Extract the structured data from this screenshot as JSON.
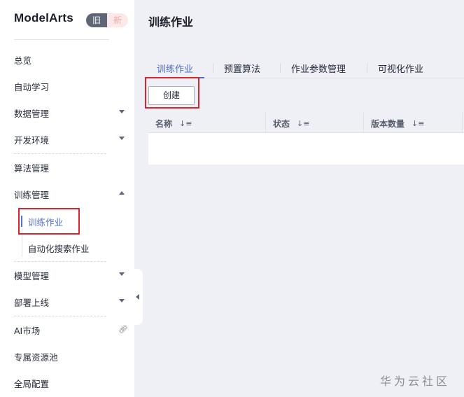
{
  "sidebar": {
    "brand": "ModelArts",
    "version_old": "旧",
    "version_new": "新",
    "items": [
      {
        "label": "总览"
      },
      {
        "label": "自动学习"
      },
      {
        "label": "数据管理"
      },
      {
        "label": "开发环境"
      },
      {
        "label": "算法管理"
      },
      {
        "label": "训练管理"
      },
      {
        "label": "模型管理"
      },
      {
        "label": "部署上线"
      },
      {
        "label": "AI市场"
      },
      {
        "label": "专属资源池"
      },
      {
        "label": "全局配置"
      }
    ],
    "sub_items": [
      {
        "label": "训练作业",
        "active": true
      },
      {
        "label": "自动化搜索作业"
      }
    ],
    "link_icon": "link-icon"
  },
  "main": {
    "title": "训练作业",
    "tabs": [
      {
        "label": "训练作业",
        "active": true
      },
      {
        "label": "预置算法"
      },
      {
        "label": "作业参数管理"
      },
      {
        "label": "可视化作业"
      }
    ],
    "create_label": "创建",
    "table": {
      "columns": [
        {
          "label": "名称",
          "sort_icon": "sort-icon"
        },
        {
          "label": "状态",
          "sort_icon": "sort-icon"
        },
        {
          "label": "版本数量",
          "sort_icon": "sort-icon"
        }
      ]
    }
  },
  "watermark": "华为云社区",
  "colors": {
    "accent": "#526ecc",
    "highlight_border": "#d8242c",
    "sidebar_bg": "#ffffff",
    "page_bg": "#eef0f5"
  }
}
